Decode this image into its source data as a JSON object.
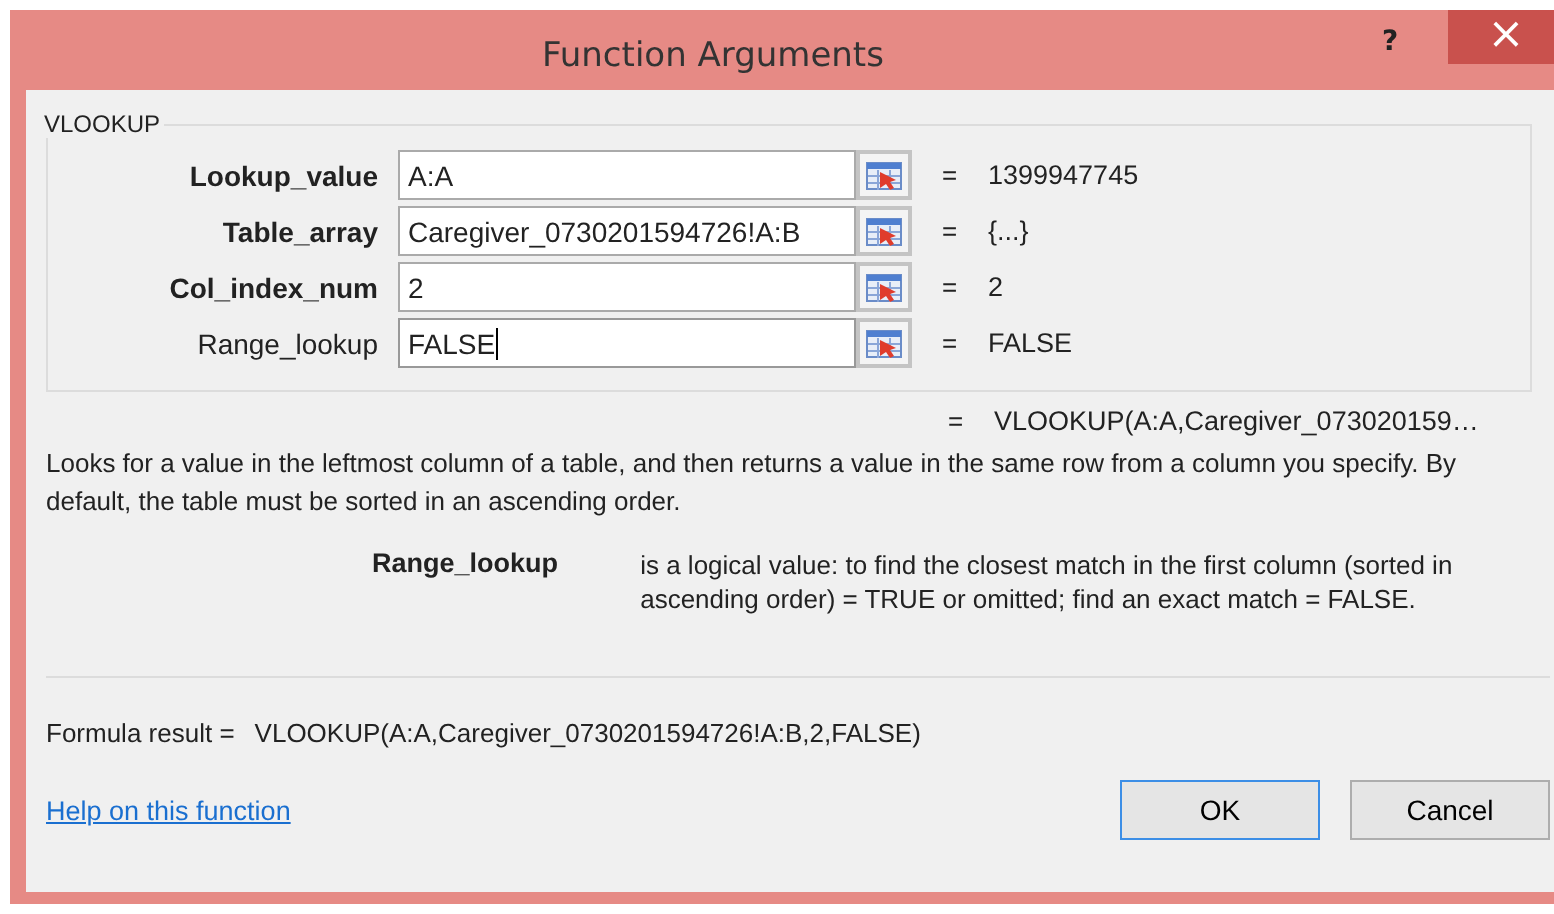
{
  "window": {
    "title": "Function Arguments",
    "help_glyph": "?",
    "close_glyph": "×"
  },
  "group": {
    "title": "VLOOKUP",
    "arguments": [
      {
        "name": "Lookup_value",
        "required": true,
        "value": "A:A",
        "result": "1399947745",
        "focused": false
      },
      {
        "name": "Table_array",
        "required": true,
        "value": "Caregiver_0730201594726!A:B",
        "result": "{...}",
        "focused": false
      },
      {
        "name": "Col_index_num",
        "required": true,
        "value": "2",
        "result": "2",
        "focused": false
      },
      {
        "name": "Range_lookup",
        "required": false,
        "value": "FALSE",
        "result": "FALSE",
        "focused": true
      }
    ]
  },
  "equals": "=",
  "overall_result": "VLOOKUP(A:A,Caregiver_073020159…",
  "description": "Looks for a value in the leftmost column of a table, and then returns a value in the same row from a column you specify. By default, the table must be sorted in an ascending order.",
  "argument_help": {
    "name": "Range_lookup",
    "text": "is a logical value: to find the closest match in the first column (sorted in ascending order) = TRUE or omitted; find an exact match = FALSE."
  },
  "formula_result": {
    "label": "Formula result =",
    "value": "VLOOKUP(A:A,Caregiver_0730201594726!A:B,2,FALSE)"
  },
  "help_link": "Help on this function",
  "buttons": [
    {
      "label": "OK",
      "default": true
    },
    {
      "label": "Cancel",
      "default": false
    }
  ]
}
